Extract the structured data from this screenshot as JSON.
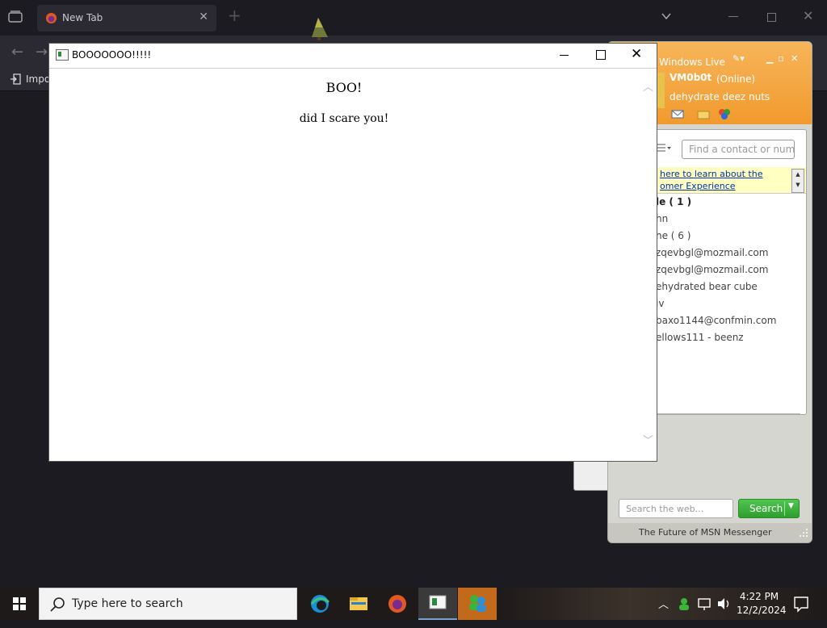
{
  "browser": {
    "tab_title": "New Tab",
    "bookmarks_import": "Impo"
  },
  "msn": {
    "brand": "Windows Live",
    "username": "VM0b0t",
    "status": "(Online)",
    "personal_message": "dehydrate deez nuts",
    "find_placeholder": "Find a contact or number",
    "banner_line1": "here to learn about the",
    "banner_line2": "omer Experience",
    "contacts": [
      {
        "label": "le ( 1 )",
        "group": true
      },
      {
        "label": "hn",
        "group": false
      },
      {
        "label": "ne ( 6 )",
        "group": false
      },
      {
        "label": "zqevbgl@mozmail.com",
        "group": false
      },
      {
        "label": "zqevbgl@mozmail.com",
        "group": false
      },
      {
        "label": "ehydrated bear cube",
        "group": false
      },
      {
        "label": "iv",
        "group": false
      },
      {
        "label": "baxo1144@confmin.com",
        "group": false
      },
      {
        "label": "ellows111 - beenz",
        "group": false
      }
    ],
    "search_placeholder": "Search the web...",
    "search_button": "Search",
    "footer": "The Future of MSN Messenger"
  },
  "popup": {
    "title": "BOOOOOOO!!!!!",
    "heading": "BOO!",
    "text": "did I scare you!"
  },
  "taskbar": {
    "search_placeholder": "Type here to search",
    "time": "4:22 PM",
    "date": "12/2/2024"
  }
}
